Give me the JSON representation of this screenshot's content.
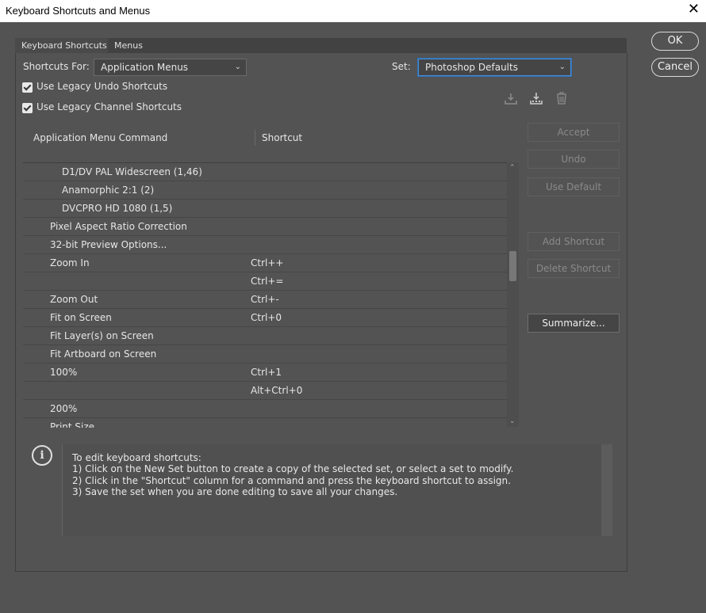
{
  "window": {
    "title": "Keyboard Shortcuts and Menus",
    "close_glyph": "✕"
  },
  "tabs": [
    {
      "label": "Keyboard Shortcuts",
      "active": true
    },
    {
      "label": "Menus",
      "active": false
    }
  ],
  "shortcuts_for": {
    "label": "Shortcuts For:",
    "value": "Application Menus"
  },
  "set": {
    "label": "Set:",
    "value": "Photoshop Defaults"
  },
  "checkboxes": [
    {
      "label": "Use Legacy Undo Shortcuts",
      "checked": true
    },
    {
      "label": "Use Legacy Channel Shortcuts",
      "checked": true
    }
  ],
  "set_icons": [
    "save-set-icon",
    "new-set-icon",
    "delete-set-icon"
  ],
  "columns": {
    "command": "Application Menu Command",
    "shortcut": "Shortcut"
  },
  "rows": [
    {
      "command": "D1/DV PAL Widescreen (1,46)",
      "shortcut": "",
      "indent": 2
    },
    {
      "command": "Anamorphic 2:1 (2)",
      "shortcut": "",
      "indent": 2
    },
    {
      "command": "DVCPRO HD 1080 (1,5)",
      "shortcut": "",
      "indent": 2
    },
    {
      "command": "Pixel Aspect Ratio Correction",
      "shortcut": "",
      "indent": 1
    },
    {
      "command": "32-bit Preview Options...",
      "shortcut": "",
      "indent": 1
    },
    {
      "command": "Zoom In",
      "shortcut": "Ctrl++",
      "indent": 1
    },
    {
      "command": "",
      "shortcut": "Ctrl+=",
      "indent": 1
    },
    {
      "command": "Zoom Out",
      "shortcut": "Ctrl+-",
      "indent": 1
    },
    {
      "command": "Fit on Screen",
      "shortcut": "Ctrl+0",
      "indent": 1
    },
    {
      "command": "Fit Layer(s) on Screen",
      "shortcut": "",
      "indent": 1
    },
    {
      "command": "Fit Artboard on Screen",
      "shortcut": "",
      "indent": 1
    },
    {
      "command": "100%",
      "shortcut": "Ctrl+1",
      "indent": 1
    },
    {
      "command": "",
      "shortcut": "Alt+Ctrl+0",
      "indent": 1
    },
    {
      "command": "200%",
      "shortcut": "",
      "indent": 1
    },
    {
      "command": "Print Size",
      "shortcut": "",
      "indent": 1
    }
  ],
  "side_buttons": {
    "accept": "Accept",
    "undo": "Undo",
    "use_default": "Use Default",
    "add_shortcut": "Add Shortcut",
    "delete_shortcut": "Delete Shortcut",
    "summarize": "Summarize..."
  },
  "dialog_buttons": {
    "ok": "OK",
    "cancel": "Cancel"
  },
  "info": {
    "icon_glyph": "i",
    "lines": [
      "To edit keyboard shortcuts:",
      "1) Click on the New Set button to create a copy of the selected set, or select a set to modify.",
      "2) Click in the \"Shortcut\" column for a command and press the keyboard shortcut to assign.",
      "3) Save the set when you are done editing to save all your changes."
    ]
  }
}
